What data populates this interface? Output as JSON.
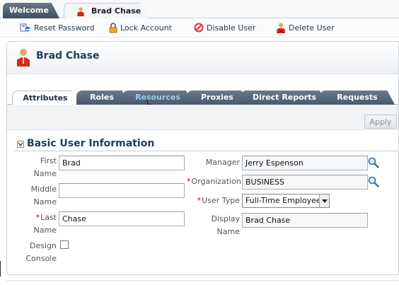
{
  "window_tabs": [
    {
      "label": "Welcome"
    },
    {
      "label": "Brad Chase"
    }
  ],
  "toolbar": {
    "reset_password": "Reset Password",
    "lock_account": "Lock Account",
    "disable_user": "Disable User",
    "delete_user": "Delete User"
  },
  "header": {
    "title": "Brad Chase"
  },
  "tabs": [
    {
      "label": "Attributes"
    },
    {
      "label": "Roles"
    },
    {
      "label": "Resources"
    },
    {
      "label": "Proxies"
    },
    {
      "label": "Direct Reports"
    },
    {
      "label": "Requests"
    }
  ],
  "apply_label": "Apply",
  "section_title": "Basic User Information",
  "fields": {
    "first_name": {
      "label_line1": "First",
      "label_line2": "Name",
      "value": "Brad"
    },
    "middle_name": {
      "label_line1": "Middle",
      "label_line2": "Name",
      "value": ""
    },
    "last_name": {
      "label_line1": "Last",
      "label_line2": "Name",
      "value": "Chase"
    },
    "design_console": {
      "label_line1": "Design",
      "label_line2": "Console"
    },
    "manager": {
      "label": "Manager",
      "value": "Jerry Espenson"
    },
    "organization": {
      "label": "Organization",
      "value": "BUSINESS"
    },
    "user_type": {
      "label": "User Type",
      "value": "Full-Time Employee"
    },
    "display_name": {
      "label": "Display Name",
      "value": "Brad Chase"
    }
  },
  "required_mark": "*",
  "colors": {
    "accent": "#1f3c5c",
    "required": "#cc0000",
    "tab_dark": "#4b5a6a",
    "hover_link": "#9cc9f0"
  }
}
